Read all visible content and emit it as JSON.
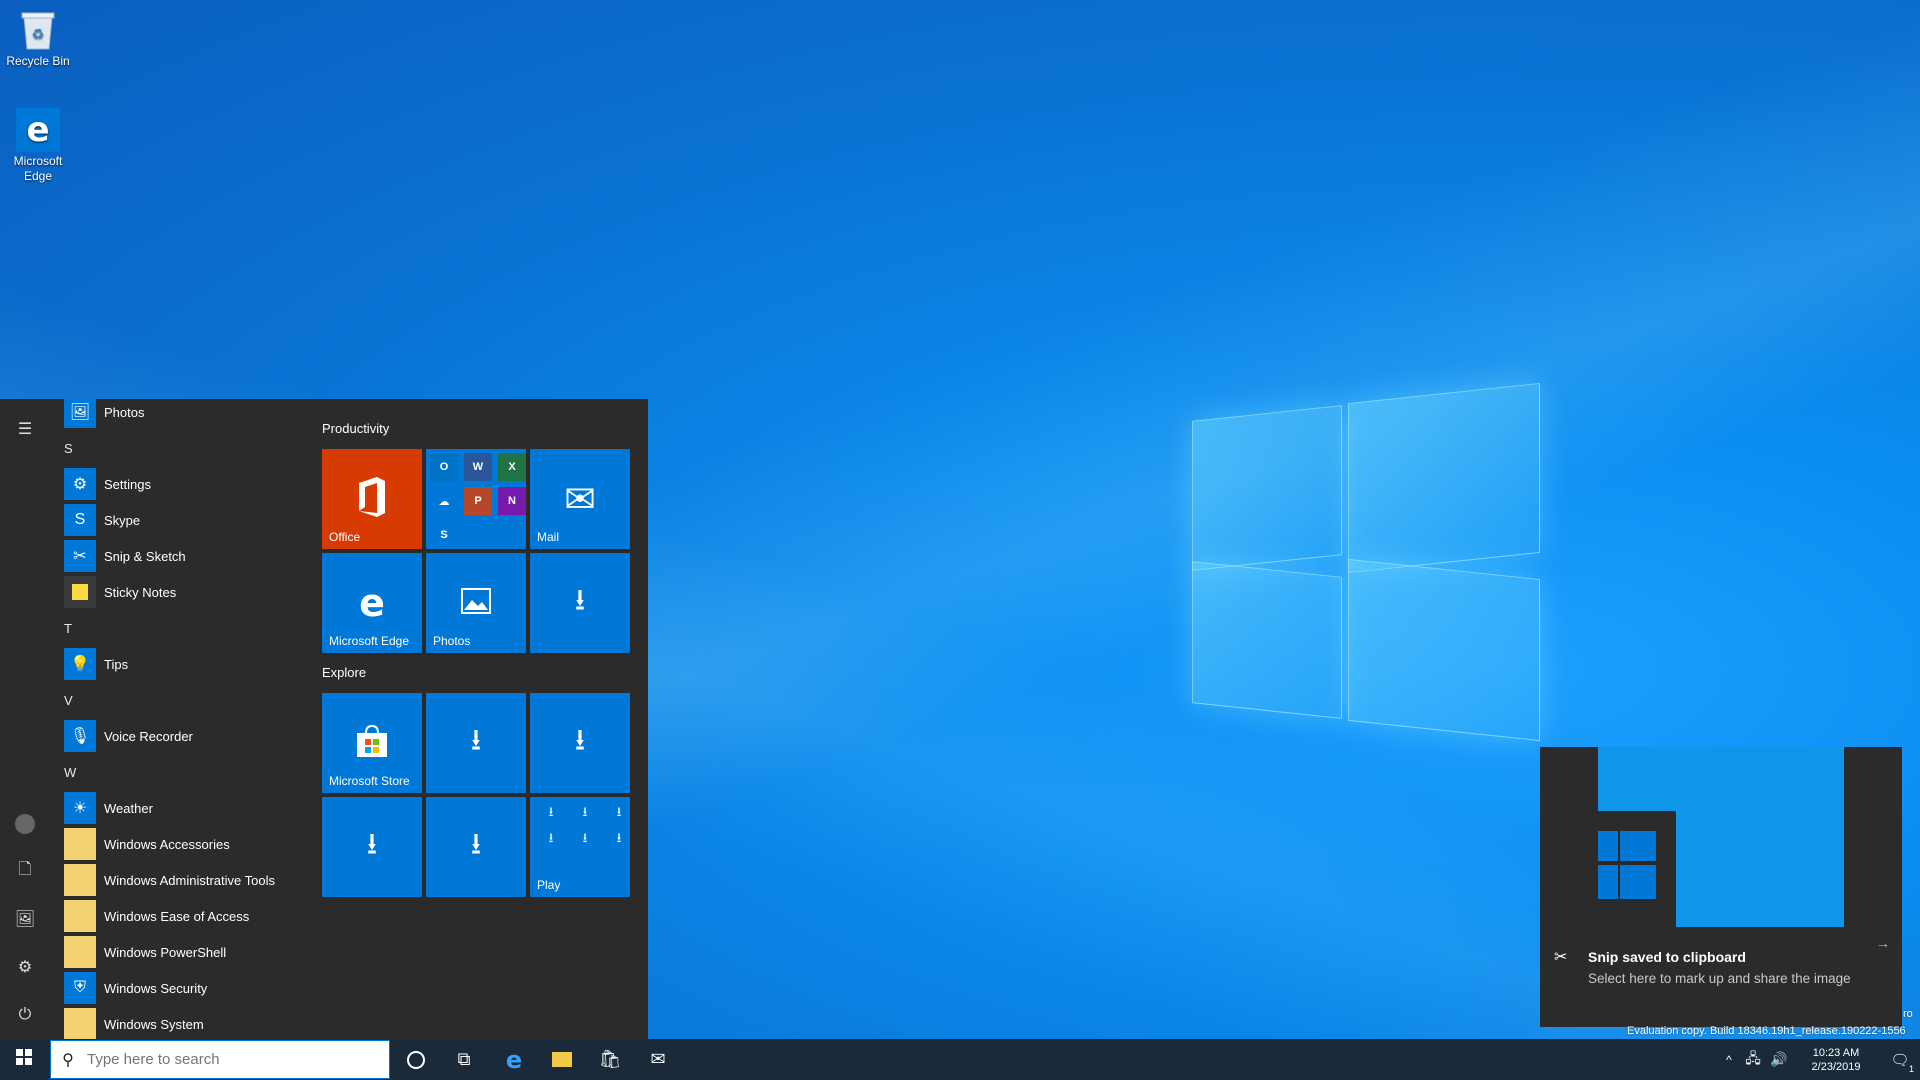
{
  "desktop": {
    "icons": [
      {
        "label": "Recycle Bin"
      },
      {
        "label": "Microsoft Edge"
      }
    ]
  },
  "start_menu": {
    "apps": [
      {
        "type": "app",
        "label": "Photos",
        "icon": "photos-icon",
        "color": "#0078d7"
      },
      {
        "type": "letter",
        "label": "S"
      },
      {
        "type": "app",
        "label": "Settings",
        "icon": "gear-icon",
        "color": "#0078d7"
      },
      {
        "type": "app",
        "label": "Skype",
        "icon": "skype-icon",
        "color": "#0078d7"
      },
      {
        "type": "app",
        "label": "Snip & Sketch",
        "icon": "snip-icon",
        "color": "#0078d7"
      },
      {
        "type": "app",
        "label": "Sticky Notes",
        "icon": "sticky-notes-icon",
        "color": "#3a3a3a"
      },
      {
        "type": "letter",
        "label": "T"
      },
      {
        "type": "app",
        "label": "Tips",
        "icon": "lightbulb-icon",
        "color": "#0078d7"
      },
      {
        "type": "letter",
        "label": "V"
      },
      {
        "type": "app",
        "label": "Voice Recorder",
        "icon": "microphone-icon",
        "color": "#0078d7"
      },
      {
        "type": "letter",
        "label": "W"
      },
      {
        "type": "app",
        "label": "Weather",
        "icon": "sun-icon",
        "color": "#0078d7"
      },
      {
        "type": "folder",
        "label": "Windows Accessories",
        "icon": "folder-icon",
        "color": "#f3d271"
      },
      {
        "type": "folder",
        "label": "Windows Administrative Tools",
        "icon": "folder-icon",
        "color": "#f3d271"
      },
      {
        "type": "folder",
        "label": "Windows Ease of Access",
        "icon": "folder-icon",
        "color": "#f3d271"
      },
      {
        "type": "folder",
        "label": "Windows PowerShell",
        "icon": "folder-icon",
        "color": "#f3d271"
      },
      {
        "type": "app",
        "label": "Windows Security",
        "icon": "shield-icon",
        "color": "#0078d7"
      },
      {
        "type": "folder",
        "label": "Windows System",
        "icon": "folder-icon",
        "color": "#f3d271"
      }
    ],
    "groups": {
      "productivity": "Productivity",
      "explore": "Explore"
    },
    "tiles": {
      "office": "Office",
      "mail": "Mail",
      "edge": "Microsoft Edge",
      "photos": "Photos",
      "store": "Microsoft Store",
      "play": "Play"
    },
    "colors": {
      "office": "#d83b01",
      "tile": "#0078d7"
    }
  },
  "taskbar": {
    "search_placeholder": "Type here to search",
    "time": "10:23 AM",
    "date": "2/23/2019",
    "notification_count": "1"
  },
  "toast": {
    "title": "Snip saved to clipboard",
    "body": "Select here to mark up and share the image"
  },
  "watermark": {
    "edition": "ro",
    "build": "Evaluation copy. Build 18346.19h1_release.190222-1556"
  }
}
